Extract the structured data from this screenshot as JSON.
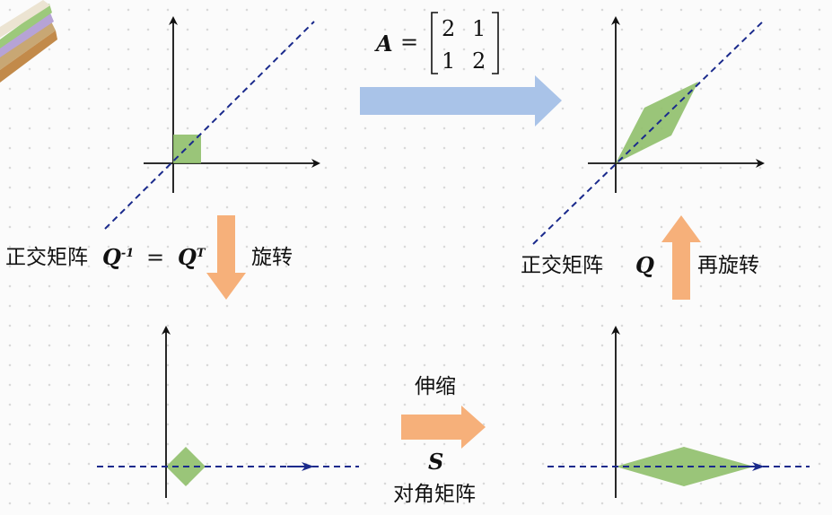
{
  "matrix": {
    "name": "A",
    "equals": "=",
    "rows": [
      [
        "2",
        "1"
      ],
      [
        "1",
        "2"
      ]
    ]
  },
  "labels": {
    "left_pre": "正交矩阵",
    "left_q": "Q",
    "left_q_sup": "-1",
    "left_eq": "=",
    "left_q2": "Q",
    "left_q2_sup": "T",
    "left_post": "旋转",
    "right_pre": "正交矩阵",
    "right_q": "Q",
    "right_post": "再旋转",
    "stretch": "伸缩",
    "s_symbol": "S",
    "diag": "对角矩阵"
  },
  "colors": {
    "shape_fill": "#8fbf6a",
    "dash_line": "#1a2a8c",
    "arrow_blue": "#a9c3e8",
    "arrow_orange": "#f6b07a",
    "axis": "#111111"
  }
}
